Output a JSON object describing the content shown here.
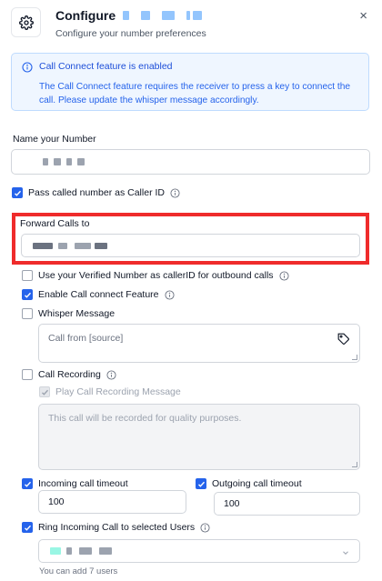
{
  "header": {
    "title": "Configure",
    "subtitle": "Configure your number preferences",
    "close": "×"
  },
  "alert": {
    "title": "Call Connect feature is enabled",
    "body": "The Call Connect feature requires the receiver to press a key to connect the call. Please update the whisper message accordingly."
  },
  "form": {
    "name_label": "Name your Number",
    "pass_caller_id_label": "Pass called number as Caller ID",
    "forward_label": "Forward Calls to",
    "verified_number_label": "Use your Verified Number as callerID for outbound calls",
    "call_connect_label": "Enable Call connect Feature",
    "whisper_label": "Whisper Message",
    "whisper_placeholder": "Call from [source]",
    "recording_label": "Call Recording",
    "play_recording_label": "Play Call Recording Message",
    "recording_placeholder": "This call will be recorded for quality purposes.",
    "incoming_timeout_label": "Incoming call timeout",
    "incoming_timeout_value": "100",
    "outgoing_timeout_label": "Outgoing call timeout",
    "outgoing_timeout_value": "100",
    "ring_users_label": "Ring Incoming Call to selected Users",
    "users_helper": "You can add 7 users"
  },
  "colors": {
    "accent": "#2563eb",
    "highlight_border": "#ef2b2b",
    "alert_bg": "#eff6ff"
  },
  "icons": {
    "gear": "gear-icon",
    "close": "close-icon",
    "info": "info-icon",
    "tag": "tag-icon",
    "check": "check-icon",
    "chevron": "chevron-down-icon"
  }
}
